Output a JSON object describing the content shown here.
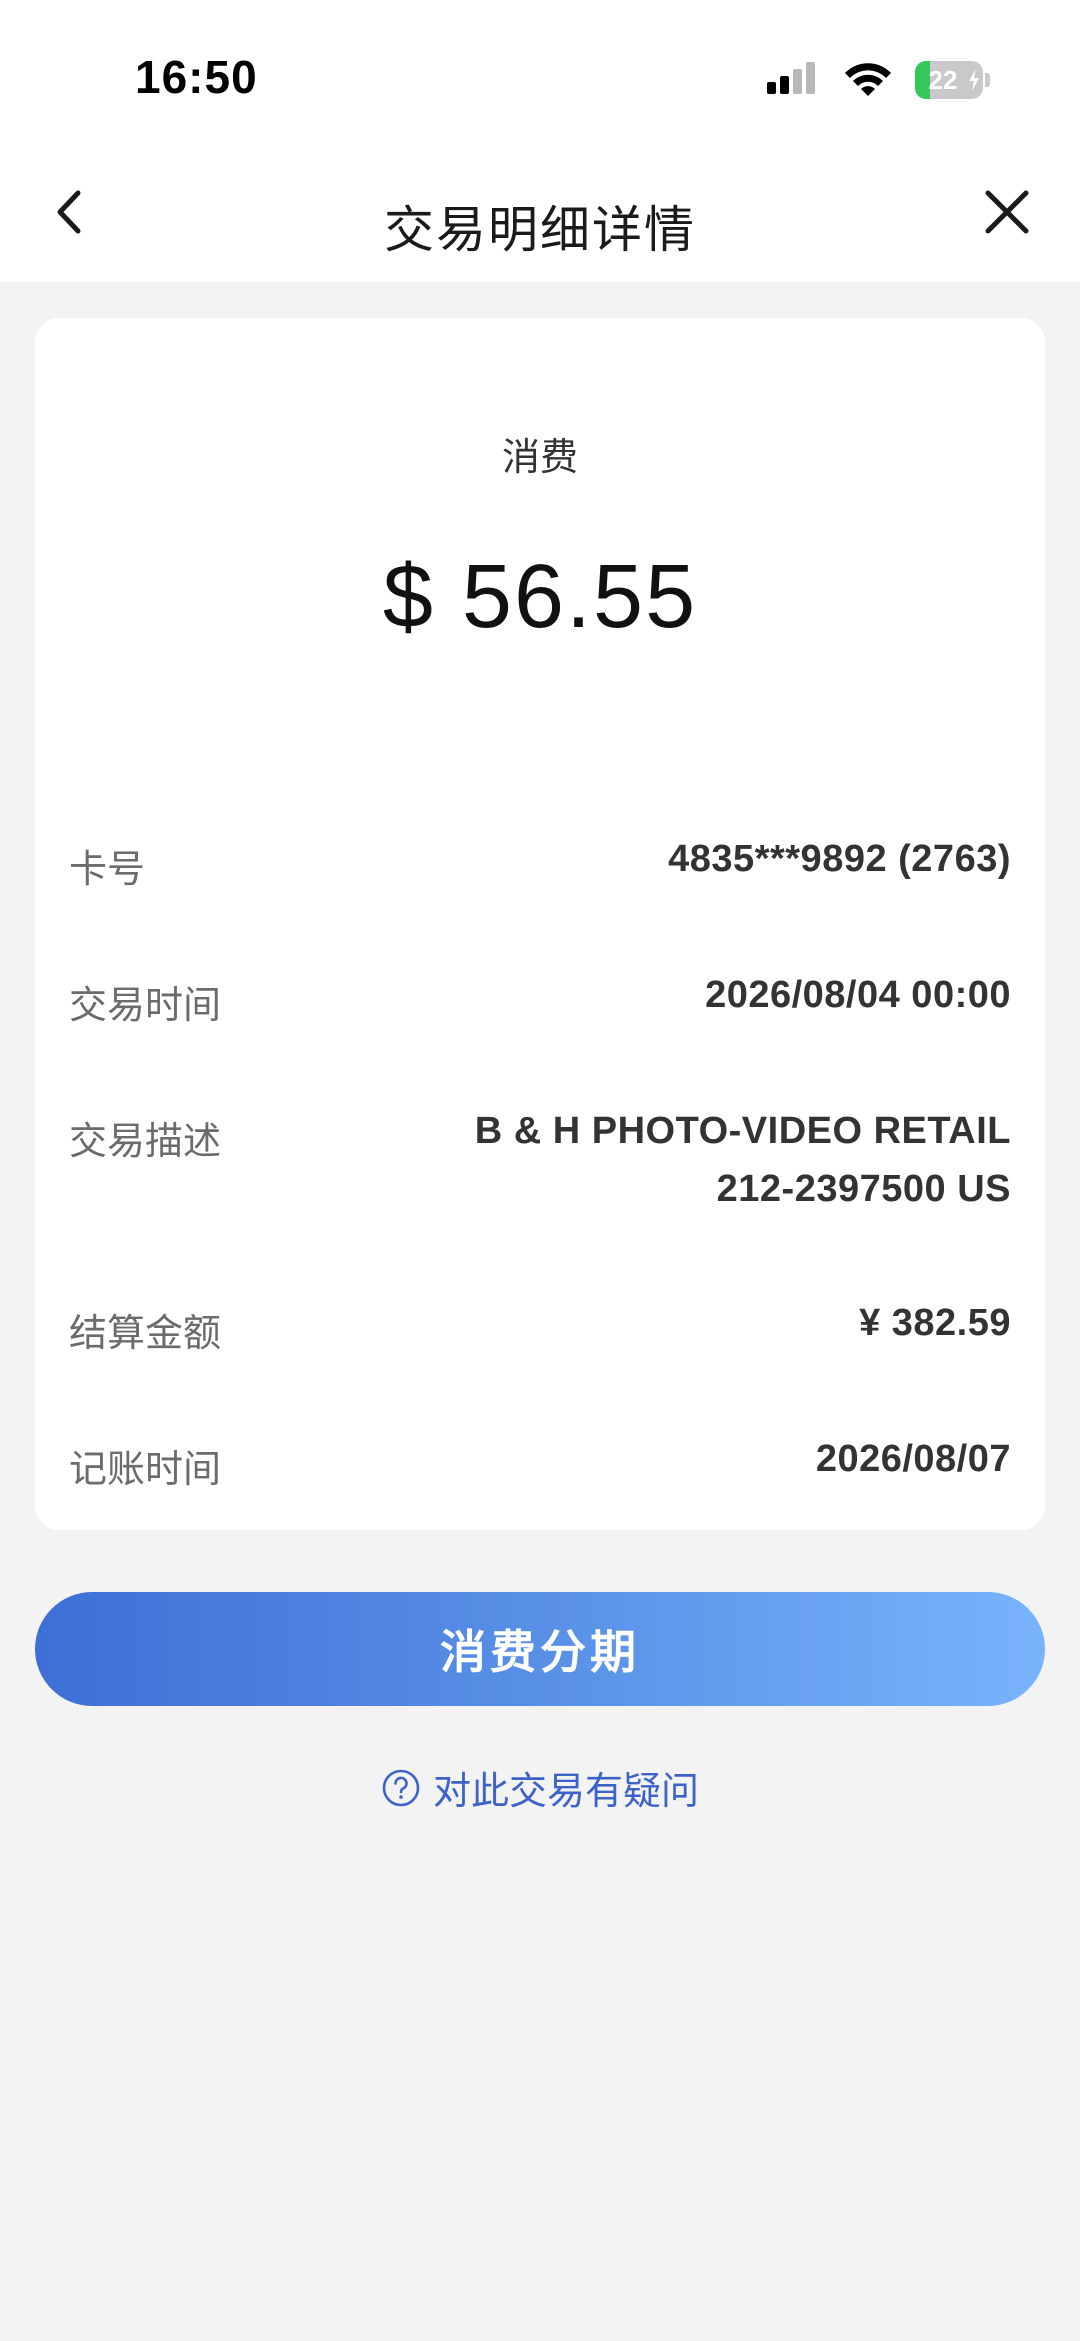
{
  "status_bar": {
    "time": "16:50",
    "battery_level": "22",
    "battery_fill_percent": 22,
    "colors": {
      "battery_fill": "#34c759",
      "battery_body": "#c9c9cb"
    }
  },
  "nav": {
    "back_icon": "chevron-left-icon",
    "title": "交易明细详情",
    "close_icon": "close-icon"
  },
  "transaction": {
    "type": "消费",
    "amount": "$ 56.55",
    "rows": [
      {
        "label": "卡号",
        "value": [
          "4835***9892 (2763)"
        ]
      },
      {
        "label": "交易时间",
        "value": [
          "2026/08/04 00:00"
        ]
      },
      {
        "label": "交易描述",
        "value": [
          "B & H PHOTO-VIDEO RETAIL",
          "212-2397500 US"
        ]
      },
      {
        "label": "结算金额",
        "value": [
          "¥ 382.59"
        ]
      },
      {
        "label": "记账时间",
        "value": [
          "2026/08/07"
        ]
      }
    ]
  },
  "actions": {
    "installment_label": "消费分期",
    "help_icon": "question-circle-icon",
    "help_label": "对此交易有疑问"
  },
  "colors": {
    "accent": "#3d63c8",
    "button_gradient_start": "#3d6fd6",
    "button_gradient_end": "#79b3fb",
    "background": "#f3f3f4"
  }
}
